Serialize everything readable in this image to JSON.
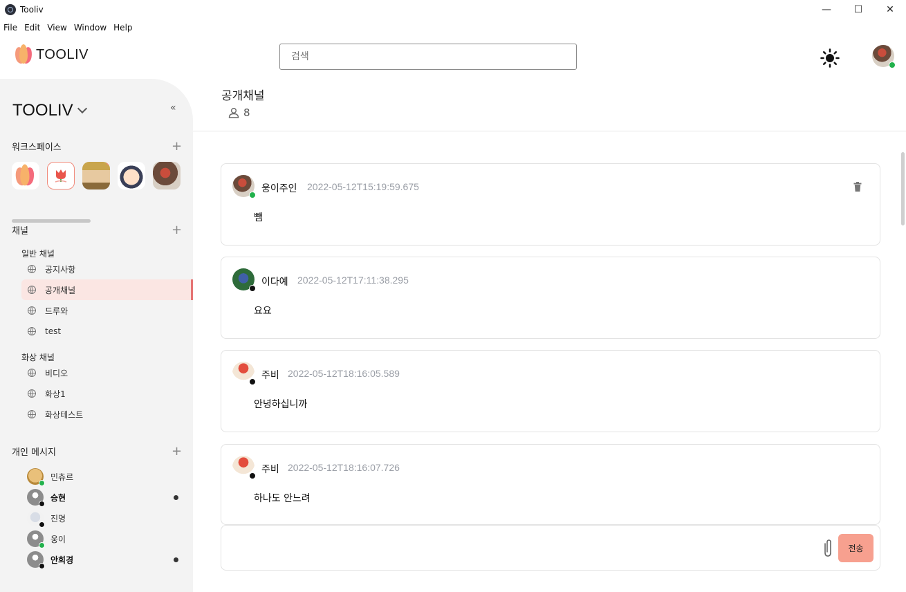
{
  "window": {
    "title": "Tooliv",
    "controls": {
      "minimize": "—",
      "maximize": "☐",
      "close": "✕"
    }
  },
  "menu": [
    "File",
    "Edit",
    "View",
    "Window",
    "Help"
  ],
  "header": {
    "logo_text": "TOOLIV",
    "search_placeholder": "검색",
    "theme_icon": "sun-icon"
  },
  "sidebar": {
    "workspace_title": "TOOLIV",
    "collapse_label": "«",
    "workspaces_label": "워크스페이스",
    "channels_label": "채널",
    "general_group": "일반 채널",
    "general_channels": [
      "공지사항",
      "공개채널",
      "드루와",
      "test"
    ],
    "video_group": "화상 채널",
    "video_channels": [
      "비디오",
      "화상1",
      "화상테스트"
    ],
    "dm_label": "개인 메시지",
    "dms": [
      {
        "name": "민츄르",
        "status": "online",
        "unread": false
      },
      {
        "name": "승현",
        "status": "offline",
        "unread": true
      },
      {
        "name": "진명",
        "status": "offline",
        "unread": false
      },
      {
        "name": "웅이",
        "status": "online",
        "unread": false
      },
      {
        "name": "안희경",
        "status": "offline",
        "unread": true
      }
    ],
    "plus": "+"
  },
  "channel": {
    "title": "공개채널",
    "member_count": "8"
  },
  "messages": [
    {
      "author": "웅이주인",
      "time": "2022-05-12T15:19:59.675",
      "body": "뺌",
      "status": "online",
      "deletable": true
    },
    {
      "author": "이다예",
      "time": "2022-05-12T17:11:38.295",
      "body": "요요",
      "status": "offline",
      "deletable": false
    },
    {
      "author": "주비",
      "time": "2022-05-12T18:16:05.589",
      "body": "안녕하십니까",
      "status": "offline",
      "deletable": false
    },
    {
      "author": "주비",
      "time": "2022-05-12T18:16:07.726",
      "body": "하나도 안느려",
      "status": "offline",
      "deletable": false
    }
  ],
  "composer": {
    "send_label": "전송"
  },
  "colors": {
    "accent": "#f7a08f",
    "active_channel_bg": "#fbe6e3",
    "online": "#22b14c"
  }
}
